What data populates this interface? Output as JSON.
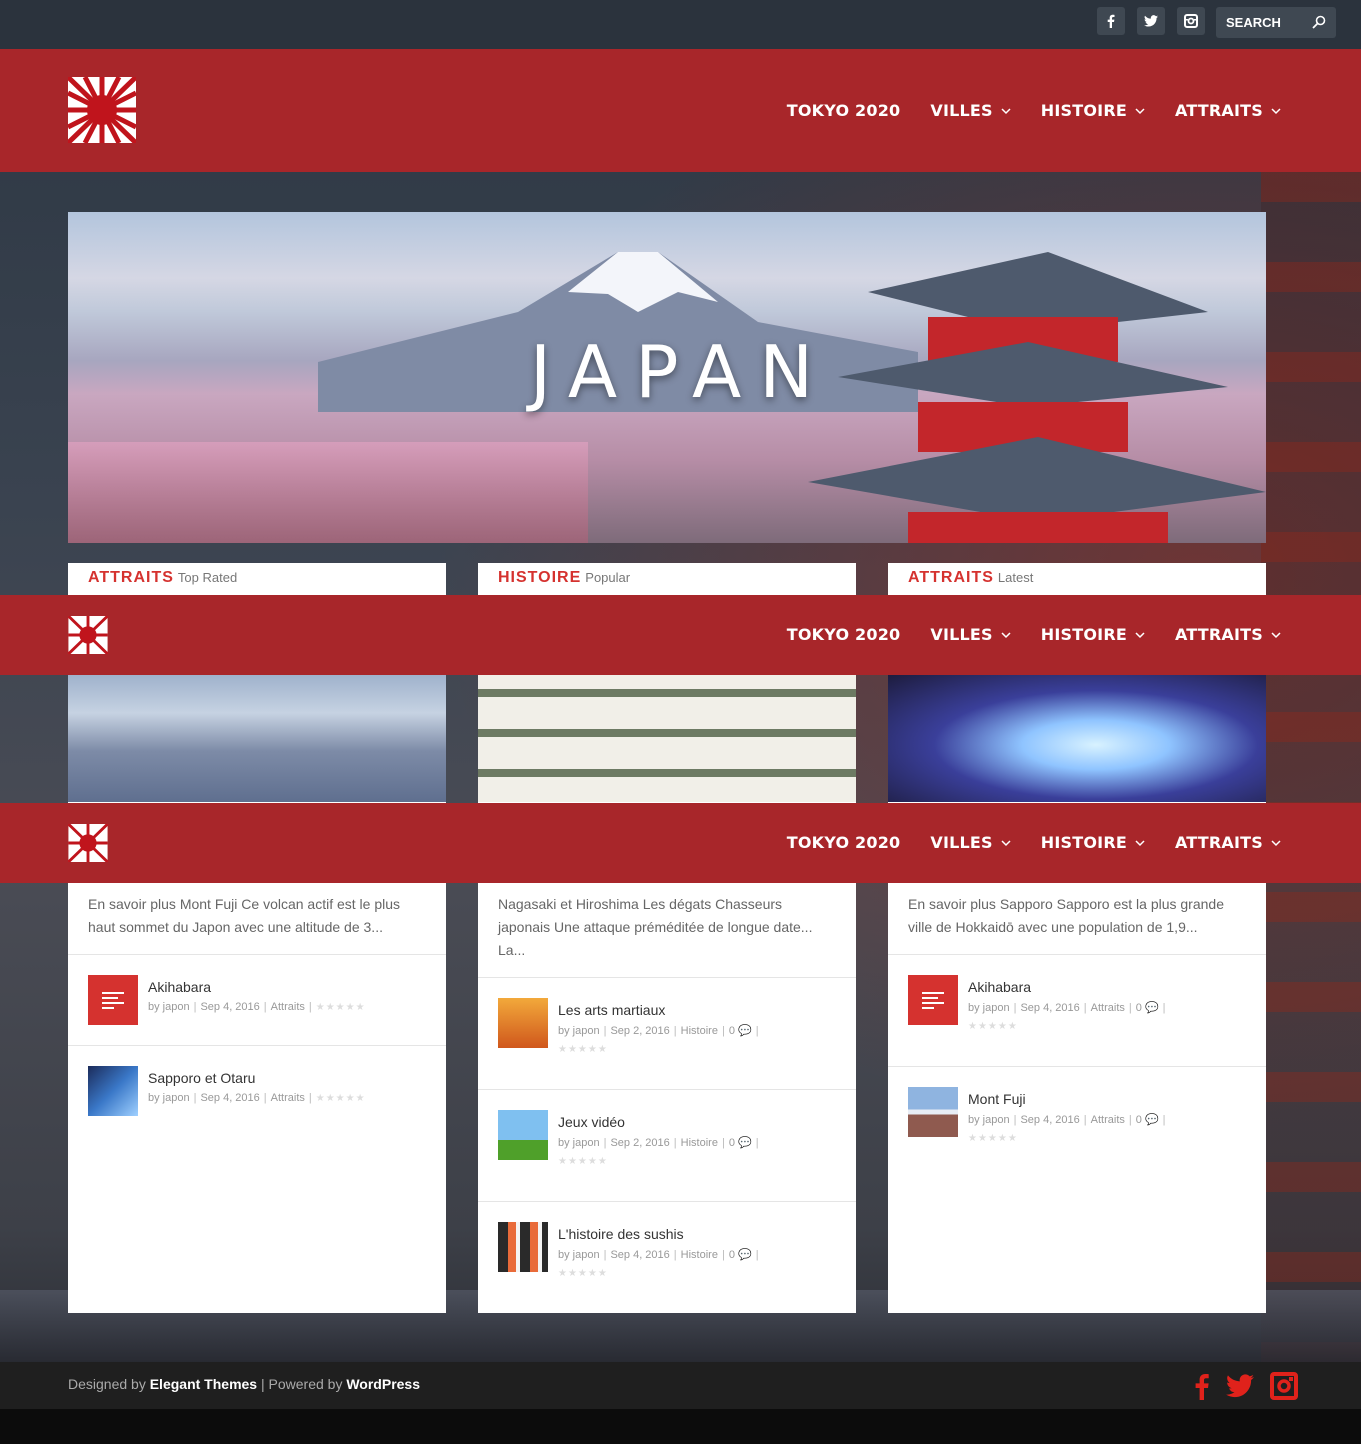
{
  "topbar": {
    "search_placeholder": "SEARCH",
    "social": [
      "facebook-icon",
      "twitter-icon",
      "instagram-icon"
    ]
  },
  "nav": {
    "items": [
      {
        "label": "TOKYO 2020",
        "has_dropdown": false
      },
      {
        "label": "VILLES",
        "has_dropdown": true
      },
      {
        "label": "HISTOIRE",
        "has_dropdown": true
      },
      {
        "label": "ATTRAITS",
        "has_dropdown": true
      }
    ]
  },
  "hero": {
    "title": "JAPAN"
  },
  "cards": [
    {
      "category": "ATTRAITS",
      "tab": "Top Rated",
      "excerpt": "En savoir plus Mont Fuji Ce volcan actif est le plus haut sommet du Japon avec une altitude de 3...",
      "posts": [
        {
          "title": "Akihabara",
          "author": "by japon",
          "date": "Sep 4, 2016",
          "category": "Attraits"
        },
        {
          "title": "Sapporo et Otaru",
          "author": "by japon",
          "date": "Sep 4, 2016",
          "category": "Attraits"
        }
      ]
    },
    {
      "category": "HISTOIRE",
      "tab": "Popular",
      "excerpt": "Nagasaki et Hiroshima Les dégats Chasseurs japonais Une attaque préméditée de longue date... La...",
      "posts": [
        {
          "title": "Les arts martiaux",
          "author": "by japon",
          "date": "Sep 2, 2016",
          "category": "Histoire",
          "comments": "0"
        },
        {
          "title": "Jeux vidéo",
          "author": "by japon",
          "date": "Sep 2, 2016",
          "category": "Histoire",
          "comments": "0"
        },
        {
          "title": "L'histoire des sushis",
          "author": "by japon",
          "date": "Sep 4, 2016",
          "category": "Histoire",
          "comments": "0"
        }
      ]
    },
    {
      "category": "ATTRAITS",
      "tab": "Latest",
      "excerpt": "En savoir plus Sapporo Sapporo est la plus grande ville de Hokkaidō avec une population de 1,9...",
      "posts": [
        {
          "title": "Akihabara",
          "author": "by japon",
          "date": "Sep 4, 2016",
          "category": "Attraits",
          "comments": "0"
        },
        {
          "title": "Mont Fuji",
          "author": "by japon",
          "date": "Sep 4, 2016",
          "category": "Attraits",
          "comments": "0"
        }
      ]
    }
  ],
  "footer": {
    "designed_by": "Designed by",
    "designer": "Elegant Themes",
    "separator": "|",
    "powered_by": "Powered by",
    "platform": "WordPress"
  },
  "colors": {
    "brand_red": "#a8262a",
    "accent_red": "#d5322f",
    "topbar": "#2b333d"
  }
}
